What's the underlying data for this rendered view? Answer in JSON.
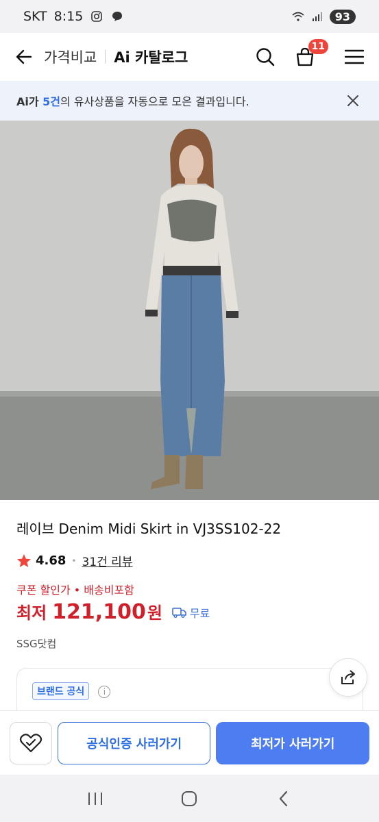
{
  "status_bar": {
    "carrier": "SKT",
    "time": "8:15",
    "battery": "93"
  },
  "header": {
    "title_main": "가격비교",
    "title_sub": "Ai 카탈로그",
    "cart_count": "11"
  },
  "notice": {
    "prefix": "Ai가 ",
    "count": "5건",
    "suffix": "의 유사상품을 자동으로 모은 결과입니다."
  },
  "product": {
    "title": "레이브 Denim Midi Skirt in VJ3SS102-22",
    "rating": "4.68",
    "review_link": "31건 리뷰",
    "coupon_text": "쿠폰 할인가 • 배송비포함",
    "price_label": "최저",
    "price": "121,100",
    "price_unit": "원",
    "shipping": "무료",
    "seller": "SSG닷컴"
  },
  "brand_card": {
    "badge": "브랜드 공식",
    "info": "i"
  },
  "actions": {
    "official_label": "공식인증 사러가기",
    "lowest_label": "최저가 사러가기"
  },
  "colors": {
    "accent_blue": "#4d7df0",
    "price_red": "#d0202c",
    "badge_red": "#f0453a"
  }
}
